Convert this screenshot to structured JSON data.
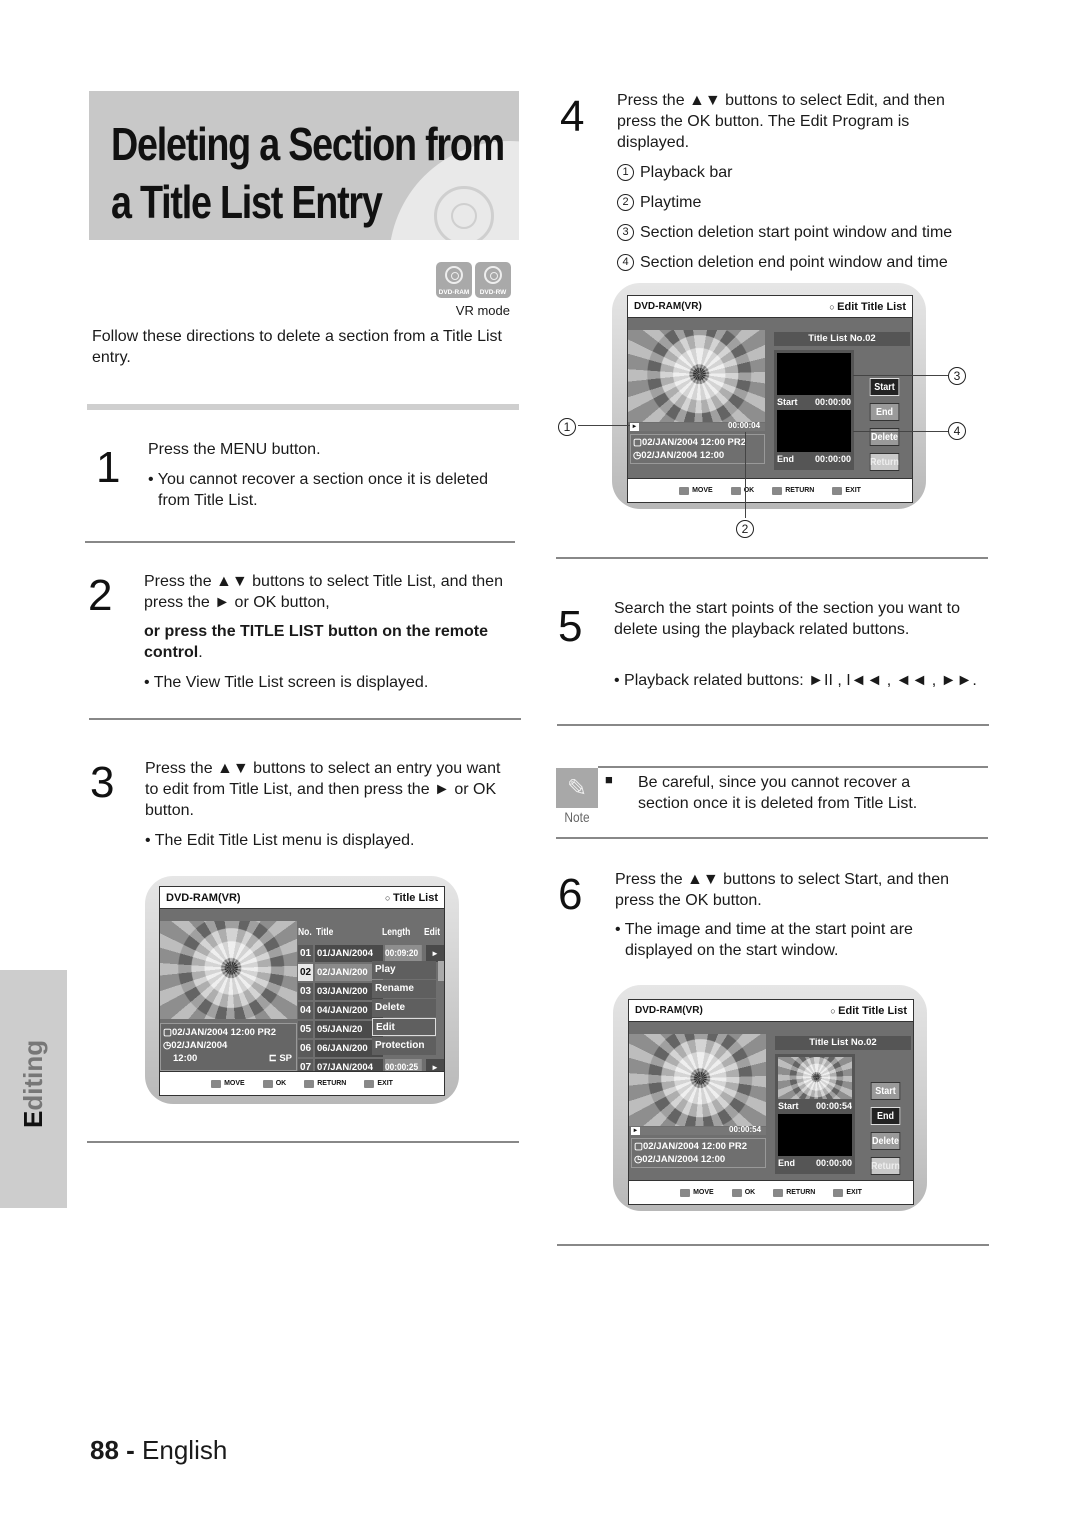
{
  "page": {
    "title_line1": "Deleting a Section from",
    "title_line2": "a Title List Entry",
    "disc_badges": [
      "DVD-RAM",
      "DVD-RW"
    ],
    "mode_label": "VR mode",
    "intro": "Follow these directions to delete a section from a Title List entry.",
    "side_tab": "Editing",
    "page_number": "88",
    "page_sep": " - ",
    "page_lang": "English"
  },
  "steps": {
    "s1": {
      "num": "1",
      "text": "Press the MENU button.",
      "bullet": "• You cannot recover a section once it is deleted from Title List."
    },
    "s2": {
      "num": "2",
      "text": "Press the ▲▼ buttons to select Title List, and then press the ► or OK button,",
      "bold": "or press the TITLE LIST button on the remote control",
      "bold_tail": ".",
      "bullet": "• The View Title List screen is displayed."
    },
    "s3": {
      "num": "3",
      "text": "Press the ▲▼ buttons to select an entry you want to edit from Title List, and then press the ► or OK button.",
      "bullet": "• The Edit Title List menu is displayed."
    },
    "s4": {
      "num": "4",
      "text": "Press the ▲▼ buttons to select Edit, and then press the OK button. The Edit Program is displayed.",
      "items": [
        {
          "mark": "1",
          "label": "Playback bar"
        },
        {
          "mark": "2",
          "label": "Playtime"
        },
        {
          "mark": "3",
          "label": "Section deletion start point window and time"
        },
        {
          "mark": "4",
          "label": "Section deletion end point window and time"
        }
      ]
    },
    "s5": {
      "num": "5",
      "text": "Search the start points of the section you want to delete using the playback related buttons.",
      "bullet": "• Playback related buttons: ►II , I◄◄ , ◄◄ , ►►."
    },
    "s6": {
      "num": "6",
      "text": "Press the ▲▼ buttons to select Start, and then press the OK button.",
      "bullet": "• The image and time at the start point are displayed on the start window."
    }
  },
  "note": {
    "label": "Note",
    "bullet": "■",
    "text": "Be careful, since you cannot recover a section once it is deleted from Title List."
  },
  "screen_title_list": {
    "source": "DVD-RAM(VR)",
    "menu_title": "Title List",
    "columns": {
      "no": "No.",
      "title": "Title",
      "length": "Length",
      "edit": "Edit"
    },
    "rows": [
      {
        "no": "01",
        "title": "01/JAN/2004",
        "length": "00:09:20"
      },
      {
        "no": "02",
        "title": "02/JAN/200",
        "length": ""
      },
      {
        "no": "03",
        "title": "03/JAN/200",
        "length": ""
      },
      {
        "no": "04",
        "title": "04/JAN/200",
        "length": ""
      },
      {
        "no": "05",
        "title": "05/JAN/20",
        "length": ""
      },
      {
        "no": "06",
        "title": "06/JAN/200",
        "length": ""
      },
      {
        "no": "07",
        "title": "07/JAN/2004",
        "length": "00:00:25"
      }
    ],
    "selected_row": "02",
    "popup_menu": [
      "Play",
      "Rename",
      "Delete",
      "Edit",
      "Protection"
    ],
    "popup_selected": "Edit",
    "info_line1": "02/JAN/2004 12:00 PR2",
    "info_line2": "02/JAN/2004",
    "info_line3": "12:00",
    "info_quality": "SP",
    "footer": [
      "MOVE",
      "OK",
      "RETURN",
      "EXIT"
    ]
  },
  "screen_edit_1": {
    "source": "DVD-RAM(VR)",
    "menu_title": "Edit Title List",
    "panel_title": "Title List No.02",
    "start_label": "Start",
    "start_time": "00:00:00",
    "end_label": "End",
    "end_time": "00:00:00",
    "playtime": "00:00:04",
    "info_line1": "02/JAN/2004 12:00 PR2",
    "info_line2": "02/JAN/2004 12:00",
    "buttons": [
      "Start",
      "End",
      "Delete",
      "Return"
    ],
    "selected_button": "Start",
    "footer": [
      "MOVE",
      "OK",
      "RETURN",
      "EXIT"
    ],
    "callouts": [
      "1",
      "2",
      "3",
      "4"
    ]
  },
  "screen_edit_2": {
    "source": "DVD-RAM(VR)",
    "menu_title": "Edit Title List",
    "panel_title": "Title List No.02",
    "start_label": "Start",
    "start_time": "00:00:54",
    "end_label": "End",
    "end_time": "00:00:00",
    "playtime": "00:00:54",
    "info_line1": "02/JAN/2004 12:00 PR2",
    "info_line2": "02/JAN/2004 12:00",
    "buttons": [
      "Start",
      "End",
      "Delete",
      "Return"
    ],
    "selected_button": "End",
    "footer": [
      "MOVE",
      "OK",
      "RETURN",
      "EXIT"
    ]
  }
}
